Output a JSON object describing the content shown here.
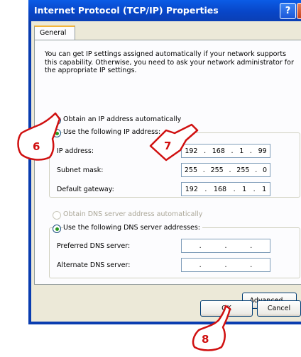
{
  "window": {
    "title": "Internet Protocol (TCP/IP) Properties",
    "help_label": "?",
    "close_label": "✕"
  },
  "tabs": [
    {
      "label": "General"
    }
  ],
  "intro_text": "You can get IP settings assigned automatically if your network supports this capability. Otherwise, you need to ask your network administrator for the appropriate IP settings.",
  "ip_mode": {
    "auto_label": "Obtain an IP address automatically",
    "manual_label": "Use the following IP address:",
    "selected": "manual"
  },
  "ip_fields": [
    {
      "label": "IP address:",
      "octets": [
        "192",
        "168",
        "1",
        "99"
      ]
    },
    {
      "label": "Subnet mask:",
      "octets": [
        "255",
        "255",
        "255",
        "0"
      ]
    },
    {
      "label": "Default gateway:",
      "octets": [
        "192",
        "168",
        "1",
        "1"
      ]
    }
  ],
  "dns_mode": {
    "auto_label": "Obtain DNS server address automatically",
    "manual_label": "Use the following DNS server addresses:",
    "selected": "manual"
  },
  "dns_fields": [
    {
      "label": "Preferred DNS server:",
      "octets": [
        "",
        "",
        "",
        ""
      ]
    },
    {
      "label": "Alternate DNS server:",
      "octets": [
        "",
        "",
        "",
        ""
      ]
    }
  ],
  "buttons": {
    "advanced": "Advanced...",
    "ok": "OK",
    "cancel": "Cancel"
  },
  "callouts": [
    "6",
    "7",
    "8"
  ],
  "colors": {
    "titlebar": "#0846c8",
    "dialog_bg": "#ece9d8",
    "callout_stroke": "#d01010"
  }
}
